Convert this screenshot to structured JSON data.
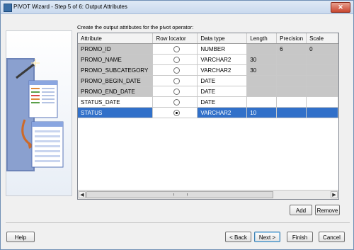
{
  "window": {
    "title": "PIVOT Wizard - Step 5 of 6: Output Attributes",
    "close_glyph": "✕"
  },
  "instruction": "Create the output attributes for the pivot operator:",
  "grid": {
    "headers": [
      "Attribute",
      "Row locator",
      "Data type",
      "Length",
      "Precision",
      "Scale"
    ],
    "rows": [
      {
        "attribute": "PROMO_ID",
        "row_locator": false,
        "data_type": "NUMBER",
        "length": "",
        "precision": "6",
        "scale": "0"
      },
      {
        "attribute": "PROMO_NAME",
        "row_locator": false,
        "data_type": "VARCHAR2",
        "length": "30",
        "precision": "",
        "scale": ""
      },
      {
        "attribute": "PROMO_SUBCATEGORY",
        "row_locator": false,
        "data_type": "VARCHAR2",
        "length": "30",
        "precision": "",
        "scale": ""
      },
      {
        "attribute": "PROMO_BEGIN_DATE",
        "row_locator": false,
        "data_type": "DATE",
        "length": "",
        "precision": "",
        "scale": ""
      },
      {
        "attribute": "PROMO_END_DATE",
        "row_locator": false,
        "data_type": "DATE",
        "length": "",
        "precision": "",
        "scale": ""
      },
      {
        "attribute": "STATUS_DATE",
        "row_locator": false,
        "data_type": "DATE",
        "length": "",
        "precision": "",
        "scale": ""
      },
      {
        "attribute": "STATUS",
        "row_locator": true,
        "data_type": "VARCHAR2",
        "length": "10",
        "precision": "",
        "scale": ""
      }
    ],
    "scroll_left_glyph": "◀",
    "scroll_right_glyph": "▶"
  },
  "buttons": {
    "add": "Add",
    "remove": "Remove",
    "help": "Help",
    "back": "< Back",
    "next": "Next >",
    "finish": "Finish",
    "cancel": "Cancel"
  },
  "colors": {
    "selection": "#3170c9",
    "disabled_cell": "#c7c7c7",
    "title_bar": "#c9d9ee"
  }
}
